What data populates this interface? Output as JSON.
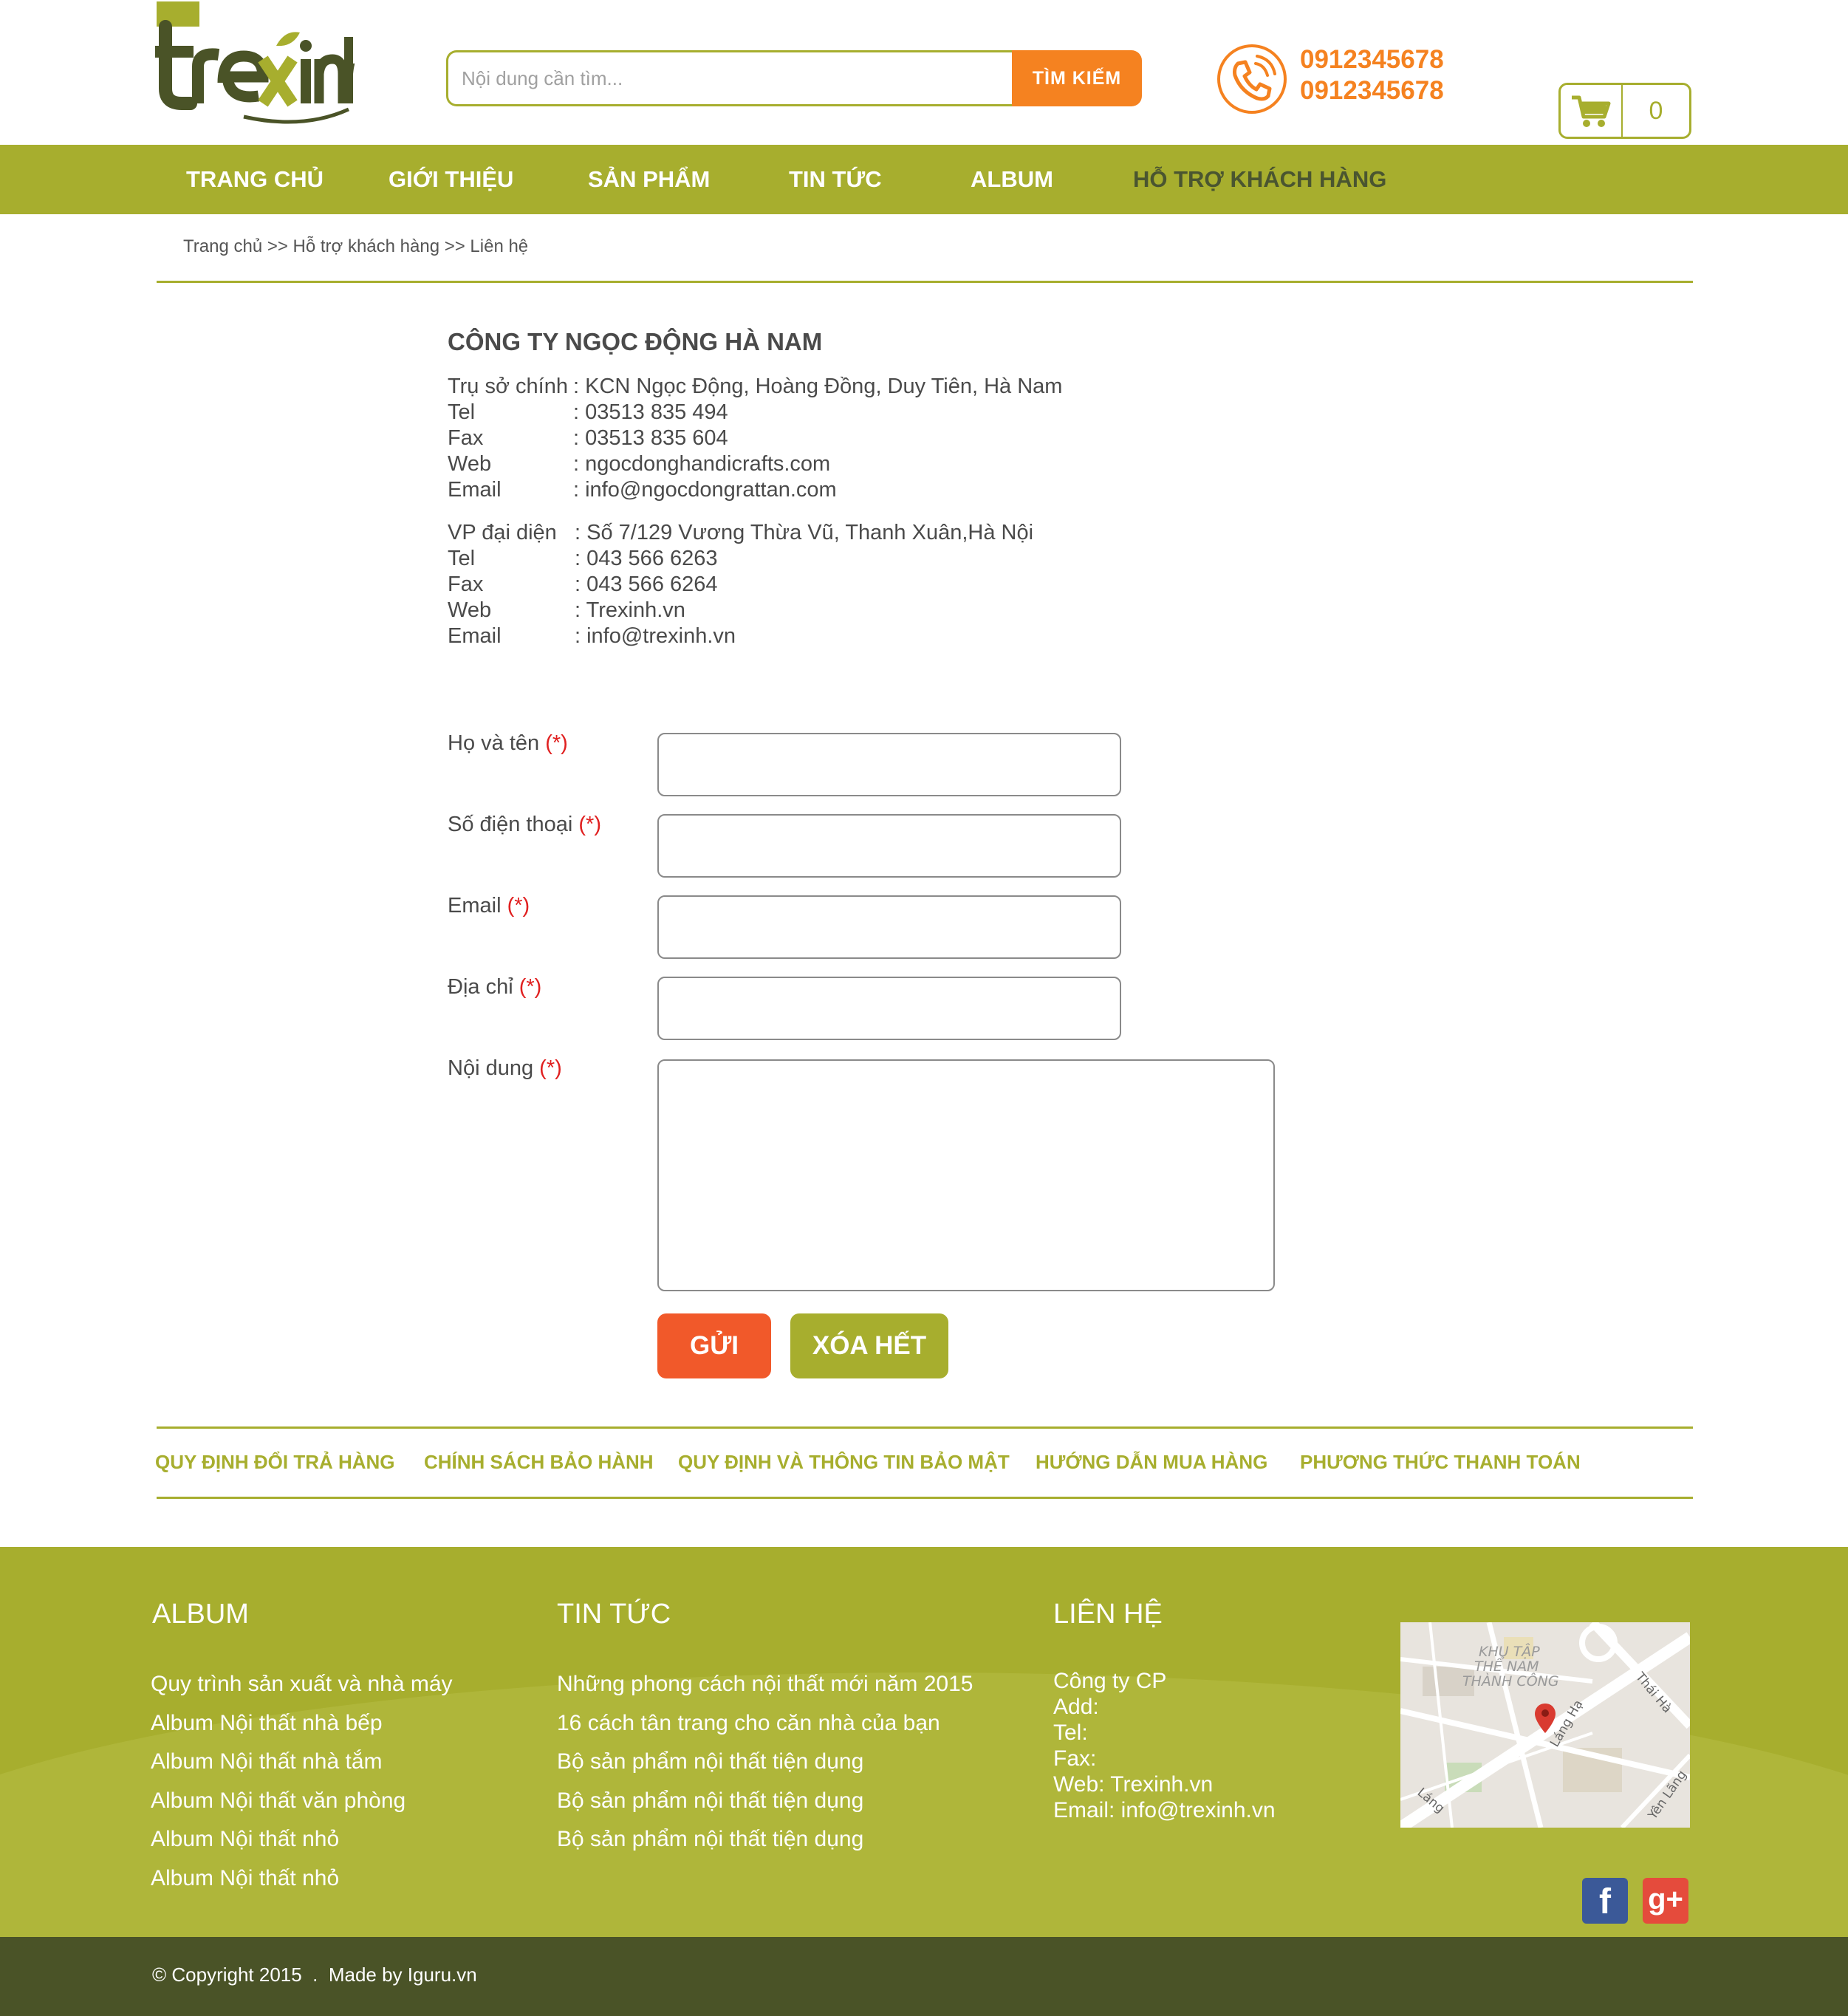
{
  "brand": {
    "name": "trexinh",
    "colors": {
      "primary": "#a7ae2e",
      "accent": "#f58220",
      "dark": "#4a5327",
      "send": "#f1592a"
    }
  },
  "header": {
    "search": {
      "placeholder": "Nội dung cần tìm...",
      "button_label": "TÌM KIẾM"
    },
    "phones": [
      "0912345678",
      "0912345678"
    ],
    "cart": {
      "count": "0",
      "icon": "cart-icon"
    },
    "phone_icon": "phone-icon"
  },
  "nav": {
    "items": [
      {
        "label": "TRANG CHỦ",
        "active": false
      },
      {
        "label": "GIỚI THIỆU",
        "active": false
      },
      {
        "label": "SẢN PHẨM",
        "active": false
      },
      {
        "label": "TIN TỨC",
        "active": false
      },
      {
        "label": "ALBUM",
        "active": false
      },
      {
        "label": "HỖ TRỢ KHÁCH HÀNG",
        "active": true
      }
    ]
  },
  "breadcrumb": "Trang chủ >> Hỗ trợ khách hàng >> Liên hệ",
  "company": {
    "name": "CÔNG TY NGỌC ĐỘNG HÀ NAM",
    "head_office": [
      {
        "key": "Trụ sở chính",
        "value": ": KCN Ngọc Động, Hoàng Đồng, Duy Tiên, Hà Nam"
      },
      {
        "key": "Tel",
        "value": ": 03513 835 494"
      },
      {
        "key": "Fax",
        "value": ": 03513 835 604"
      },
      {
        "key": "Web",
        "value": ": ngocdonghandicrafts.com"
      },
      {
        "key": "Email",
        "value": ": info@ngocdongrattan.com"
      }
    ],
    "rep_office": [
      {
        "key": "VP đại diện",
        "value": ": Số 7/129 Vương Thừa Vũ, Thanh Xuân,Hà Nội"
      },
      {
        "key": "Tel",
        "value": ": 043 566 6263"
      },
      {
        "key": "Fax",
        "value": ": 043 566 6264"
      },
      {
        "key": "Web",
        "value": ": Trexinh.vn"
      },
      {
        "key": "Email",
        "value": ": info@trexinh.vn"
      }
    ]
  },
  "form": {
    "required_mark": "(*)",
    "fields": [
      {
        "label": "Họ và tên",
        "value": ""
      },
      {
        "label": "Số điện thoại",
        "value": ""
      },
      {
        "label": "Email",
        "value": ""
      },
      {
        "label": "Địa chỉ",
        "value": ""
      },
      {
        "label": "Nội dung",
        "value": ""
      }
    ],
    "send_label": "GỬI",
    "clear_label": "XÓA HẾT"
  },
  "policy_links": [
    "QUY ĐỊNH ĐỔI TRẢ HÀNG",
    "CHÍNH SÁCH BẢO HÀNH",
    "QUY ĐỊNH VÀ THÔNG TIN BẢO MẬT",
    "HƯỚNG DẪN MUA HÀNG",
    "PHƯƠNG THỨC THANH TOÁN"
  ],
  "footer": {
    "album": {
      "title": "ALBUM",
      "items": [
        "Quy trình sản xuất và nhà máy",
        "Album Nội thất nhà bếp",
        "Album Nội thất nhà tắm",
        "Album Nội thất văn phòng",
        "Album Nội thất nhỏ",
        "Album Nội thất nhỏ"
      ]
    },
    "news": {
      "title": "TIN TỨC",
      "items": [
        "Những phong cách nội thất mới năm 2015",
        "16 cách tân trang cho căn nhà của bạn",
        "Bộ sản phẩm nội thất tiện dụng",
        "Bộ sản phẩm nội thất tiện dụng",
        "Bộ sản phẩm nội thất tiện dụng"
      ]
    },
    "contact": {
      "title": "LIÊN HỆ",
      "lines": [
        "Công ty CP",
        "Add:",
        "Tel:",
        "Fax:",
        "Web: Trexinh.vn",
        "Email: info@trexinh.vn"
      ]
    },
    "map": {
      "labels": [
        "KHU TẬP",
        "THỂ NAM",
        "THÀNH CÔNG",
        "Thái Hà",
        "Láng Hạ",
        "Láng",
        "Yên Lãng"
      ]
    },
    "social": {
      "facebook": "f",
      "googleplus": "g+"
    },
    "copyright": "© Copyright 2015  .  Made by Iguru.vn"
  }
}
